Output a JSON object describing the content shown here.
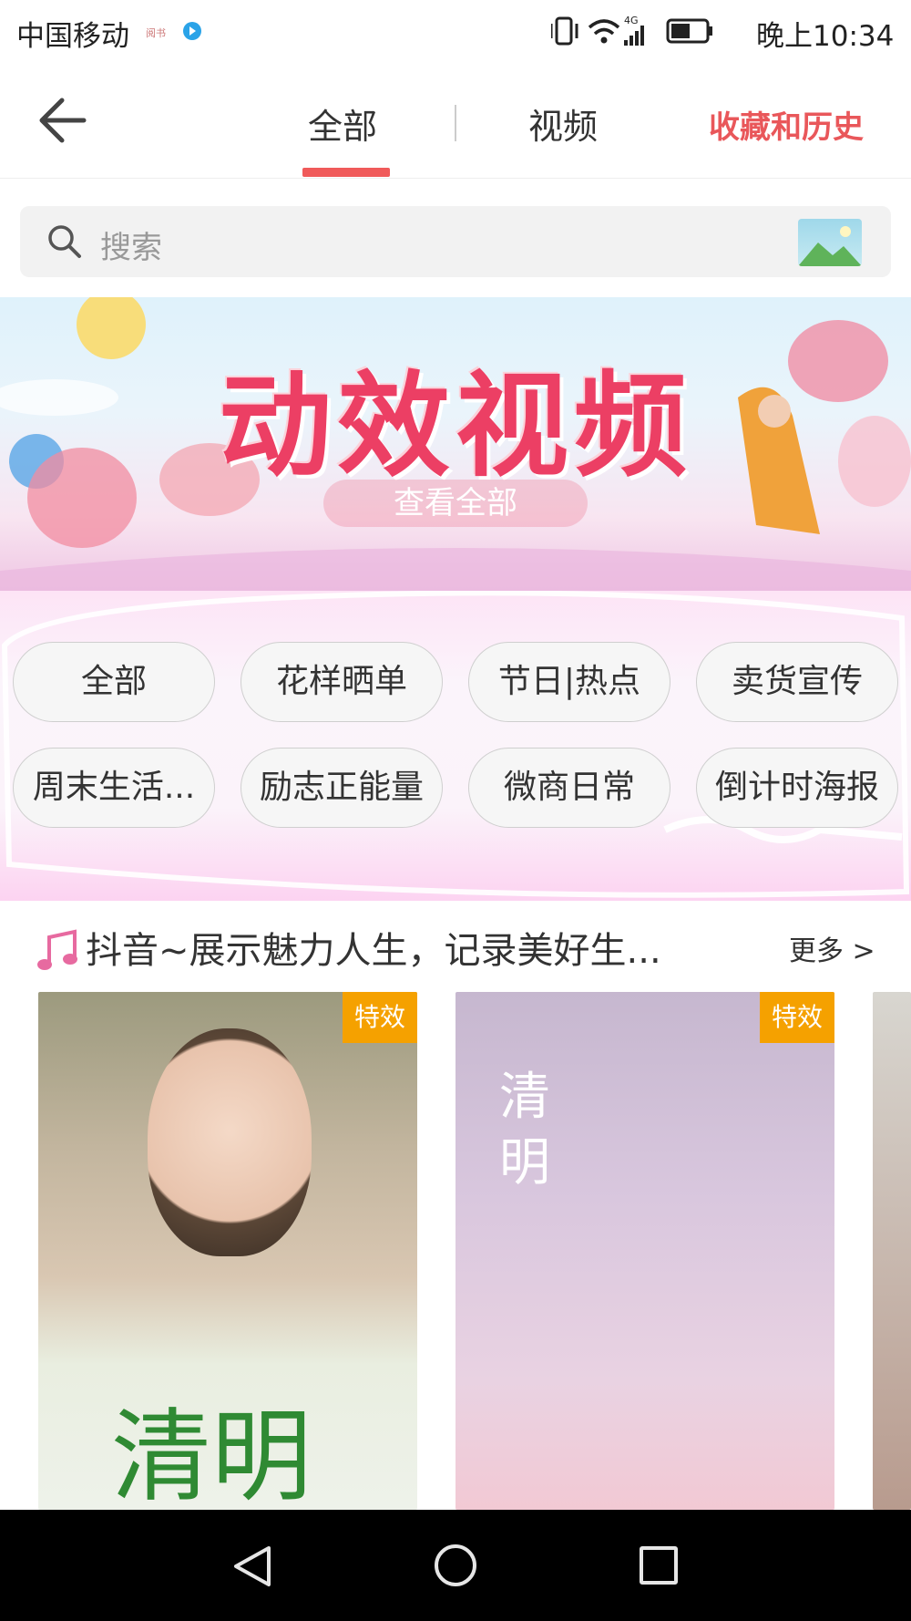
{
  "status_bar": {
    "carrier": "中国移动",
    "time": "晚上10:34",
    "network": "4G"
  },
  "nav": {
    "tabs": [
      {
        "label": "全部",
        "active": true
      },
      {
        "label": "视频",
        "active": false
      }
    ],
    "favorites_label": "收藏和历史"
  },
  "search": {
    "placeholder": "搜索"
  },
  "banner": {
    "title": "动效视频",
    "subtitle": "查看全部"
  },
  "categories": [
    "全部",
    "花样晒单",
    "节日|热点",
    "卖货宣传",
    "周末生活...",
    "励志正能量",
    "微商日常",
    "倒计时海报"
  ],
  "section": {
    "title": "抖音~展示魅力人生，记录美好生...",
    "more": "更多 >"
  },
  "cards": [
    {
      "badge": "特效",
      "text": "清明"
    },
    {
      "badge": "特效",
      "text": "清明"
    }
  ],
  "colors": {
    "accent": "#f05a5a",
    "favorites": "#e9575a",
    "badge": "#f5a100",
    "banner_title": "#ec3f64"
  }
}
